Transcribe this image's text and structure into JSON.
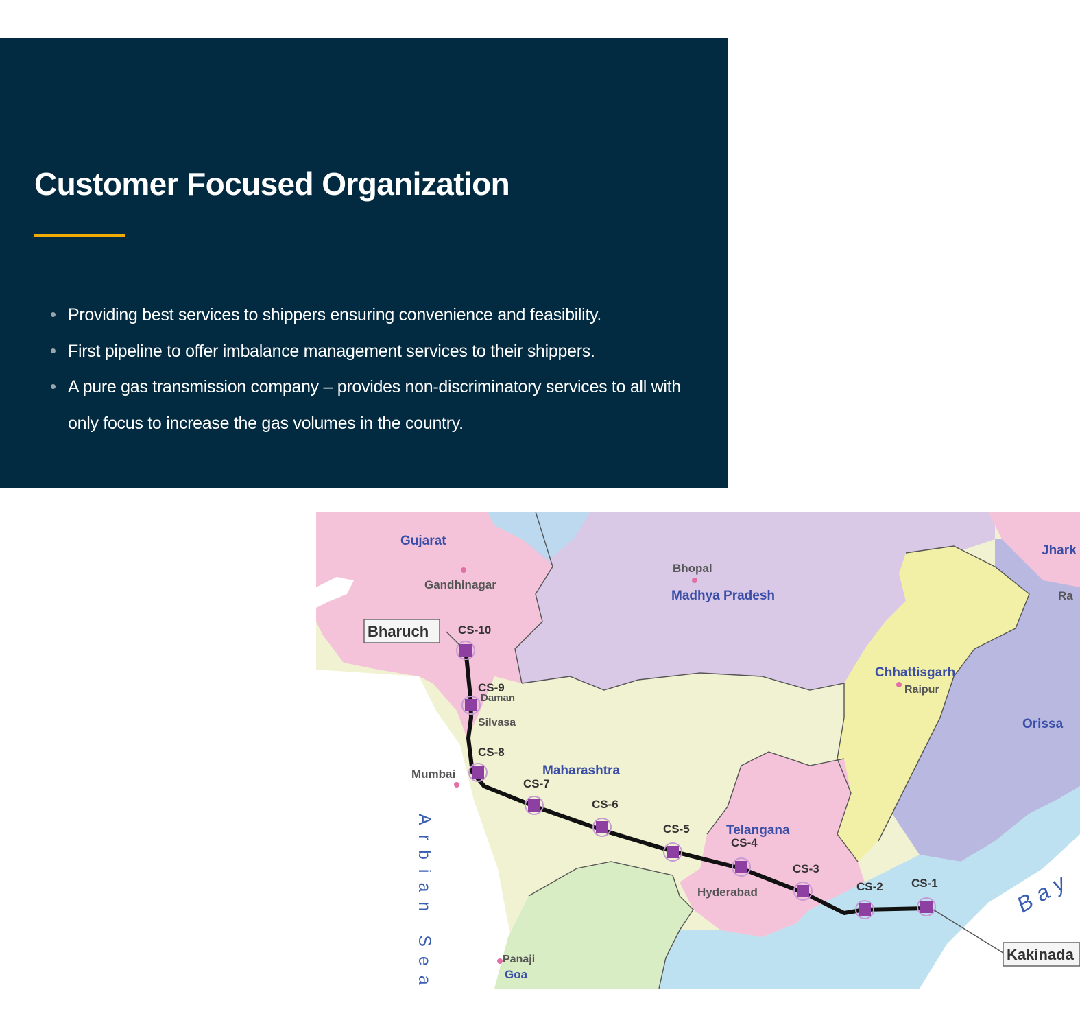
{
  "panel": {
    "title": "Customer Focused Organization",
    "accent_color": "#f0ab00",
    "background_color": "#022a40",
    "bullets": [
      "Providing best services to shippers ensuring convenience and feasibility.",
      "First pipeline to offer imbalance management services to their shippers.",
      "A pure gas transmission company – provides non-discriminatory services to all with only focus to increase the gas volumes in the country."
    ]
  },
  "map": {
    "states": {
      "gujarat": "Gujarat",
      "madhya_pradesh": "Madhya Pradesh",
      "maharashtra": "Maharashtra",
      "chhattisgarh": "Chhattisgarh",
      "telangana": "Telangana",
      "orissa": "Orissa",
      "jharkhand": "Jhark"
    },
    "cities": {
      "gandhinagar": "Gandhinagar",
      "bhopal": "Bhopal",
      "raipur": "Raipur",
      "mumbai": "Mumbai",
      "hyderabad": "Hyderabad",
      "daman": "Daman",
      "silvasa": "Silvasa",
      "panaji": "Panaji",
      "goa": "Goa",
      "ranchi": "Ra"
    },
    "endpoints": {
      "start": "Bharuch",
      "end": "Kakinada"
    },
    "stations": [
      "CS-10",
      "CS-9",
      "CS-8",
      "CS-7",
      "CS-6",
      "CS-5",
      "CS-4",
      "CS-3",
      "CS-2",
      "CS-1"
    ],
    "seas": {
      "arabian": "Arbian Sea",
      "bay": "Bay"
    },
    "colors": {
      "pipeline": "#111111",
      "station": "#8e3fa2",
      "state_label": "#3a4ea8"
    }
  }
}
